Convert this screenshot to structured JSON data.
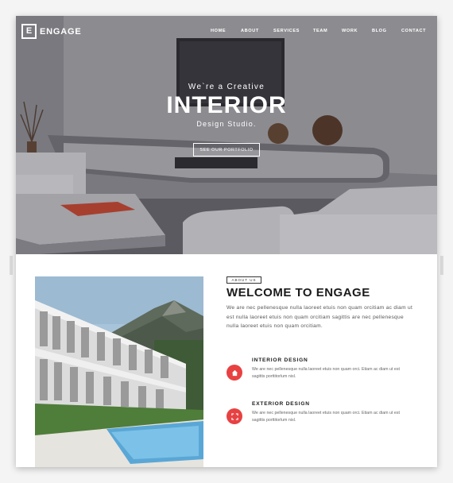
{
  "brand": {
    "logo_letter": "E",
    "name": "ENGAGE"
  },
  "nav": {
    "items": [
      "HOME",
      "ABOUT",
      "SERVICES",
      "TEAM",
      "WORK",
      "BLOG",
      "CONTACT"
    ]
  },
  "hero": {
    "subtitle_top": "We`re a Creative",
    "title": "INTERIOR",
    "subtitle_bottom": "Design Studio.",
    "cta_label": "SEE OUR PORTFOLIO"
  },
  "about": {
    "tag": "ABOUT US",
    "title": "WELCOME TO ENGAGE",
    "body": "We are nec pellenesque nulla laoreet etuis non quam orcitiam ac diam ut est nulla laoreet etuis non quam orcitiam sagittis are nec pellenesque nulla laoreet etuis non quam orcitiam.",
    "services": [
      {
        "title": "INTERIOR DESIGN",
        "text": "We are nec pellenesque nulla laoreet etuis non quam orci. Etiam ac diam ut est sagittis porttitorlum nisl.",
        "icon": "home-icon"
      },
      {
        "title": "EXTERIOR DESIGN",
        "text": "We are nec pellenesque nulla laoreet etuis non quam orci. Etiam ac diam ut est sagittis porttitorlum nisl.",
        "icon": "expand-icon"
      }
    ]
  },
  "colors": {
    "accent": "#e84142",
    "text_dark": "#1a1a1a",
    "text_body": "#555555"
  }
}
